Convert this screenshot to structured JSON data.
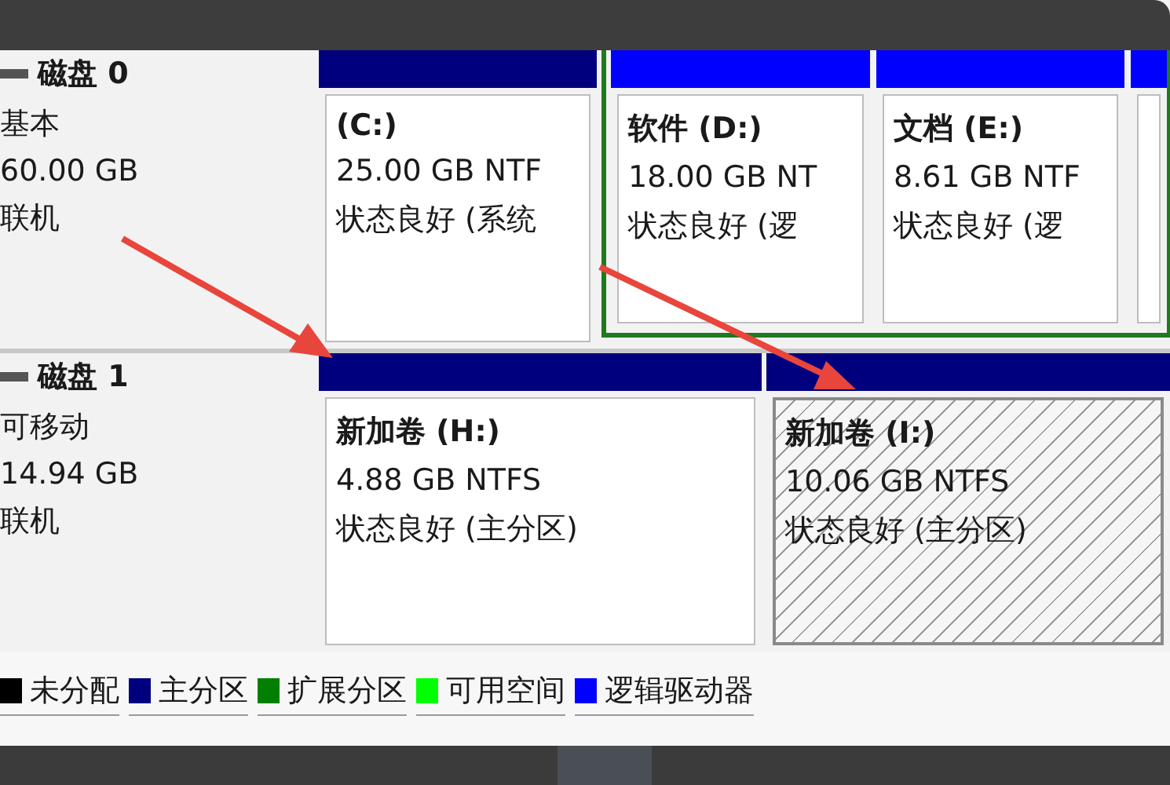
{
  "disks": [
    {
      "name": "磁盘 0",
      "type": "基本",
      "size": "60.00 GB",
      "status": "联机",
      "partitions": [
        {
          "kind": "primary",
          "selected": false,
          "name": "(C:)",
          "size": "25.00 GB NTF",
          "status": "状态良好 (系统"
        },
        {
          "kind": "extended",
          "children": [
            {
              "kind": "logical",
              "selected": false,
              "name": "软件 (D:)",
              "size": "18.00 GB NT",
              "status": "状态良好 (逻"
            },
            {
              "kind": "logical",
              "selected": false,
              "name": "文档 (E:)",
              "size": "8.61 GB NTF",
              "status": "状态良好 (逻"
            },
            {
              "kind": "logical",
              "selected": false
            }
          ]
        }
      ]
    },
    {
      "name": "磁盘 1",
      "type": "可移动",
      "size": "14.94 GB",
      "status": "联机",
      "partitions": [
        {
          "kind": "primary",
          "selected": false,
          "name": "新加卷 (H:)",
          "size": "4.88 GB NTFS",
          "status": "状态良好 (主分区)"
        },
        {
          "kind": "primary",
          "selected": true,
          "name": "新加卷 (I:)",
          "size": "10.06 GB NTFS",
          "status": "状态良好 (主分区)"
        }
      ]
    }
  ],
  "legend": [
    {
      "label": "未分配",
      "color": "#000000"
    },
    {
      "label": "主分区",
      "color": "#00007f"
    },
    {
      "label": "扩展分区",
      "color": "#007f00"
    },
    {
      "label": "可用空间",
      "color": "#00ff00"
    },
    {
      "label": "逻辑驱动器",
      "color": "#0000ff"
    }
  ]
}
